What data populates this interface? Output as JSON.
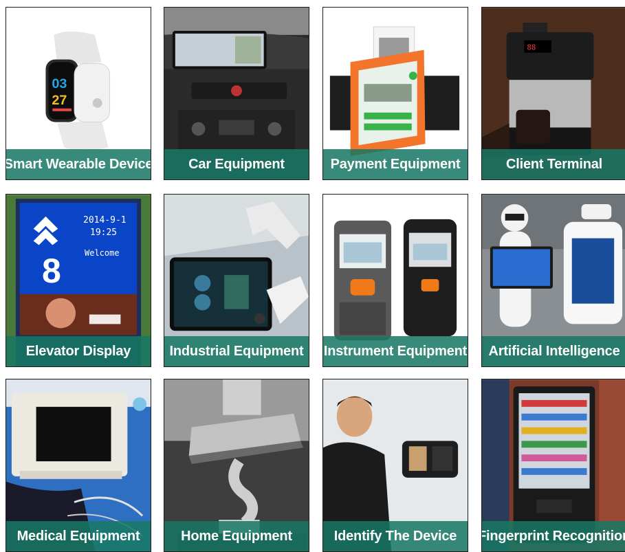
{
  "tiles": [
    {
      "id": "smart-wearable",
      "label": "Smart Wearable Device",
      "icon": "smartwatch-image"
    },
    {
      "id": "car-equipment",
      "label": "Car Equipment",
      "icon": "car-dashboard-image"
    },
    {
      "id": "payment-equipment",
      "label": "Payment Equipment",
      "icon": "payment-terminal-image"
    },
    {
      "id": "client-terminal",
      "label": "Client Terminal",
      "icon": "coffee-machine-image"
    },
    {
      "id": "elevator-display",
      "label": "Elevator Display",
      "icon": "elevator-display-image",
      "screen": {
        "date": "2014-9-1",
        "time": "19:25",
        "greeting": "Welcome",
        "floor": "8"
      }
    },
    {
      "id": "industrial-equipment",
      "label": "Industrial Equipment",
      "icon": "robot-arm-image"
    },
    {
      "id": "instrument-equipment",
      "label": "Instrument Equipment",
      "icon": "wall-detector-image"
    },
    {
      "id": "artificial-intelligence",
      "label": "Artificial Intelligence",
      "icon": "service-robot-image"
    },
    {
      "id": "medical-equipment",
      "label": "Medical Equipment",
      "icon": "patient-monitor-image"
    },
    {
      "id": "home-equipment",
      "label": "Home Equipment",
      "icon": "range-hood-image"
    },
    {
      "id": "identify-device",
      "label": "Identify The Device",
      "icon": "face-recognition-image"
    },
    {
      "id": "fingerprint-recognition",
      "label": "Fingerprint Recognition",
      "icon": "vending-machine-image"
    }
  ],
  "colors": {
    "caption_bg": "#177864",
    "caption_text": "#ffffff",
    "tile_border": "#1b1b1b"
  }
}
